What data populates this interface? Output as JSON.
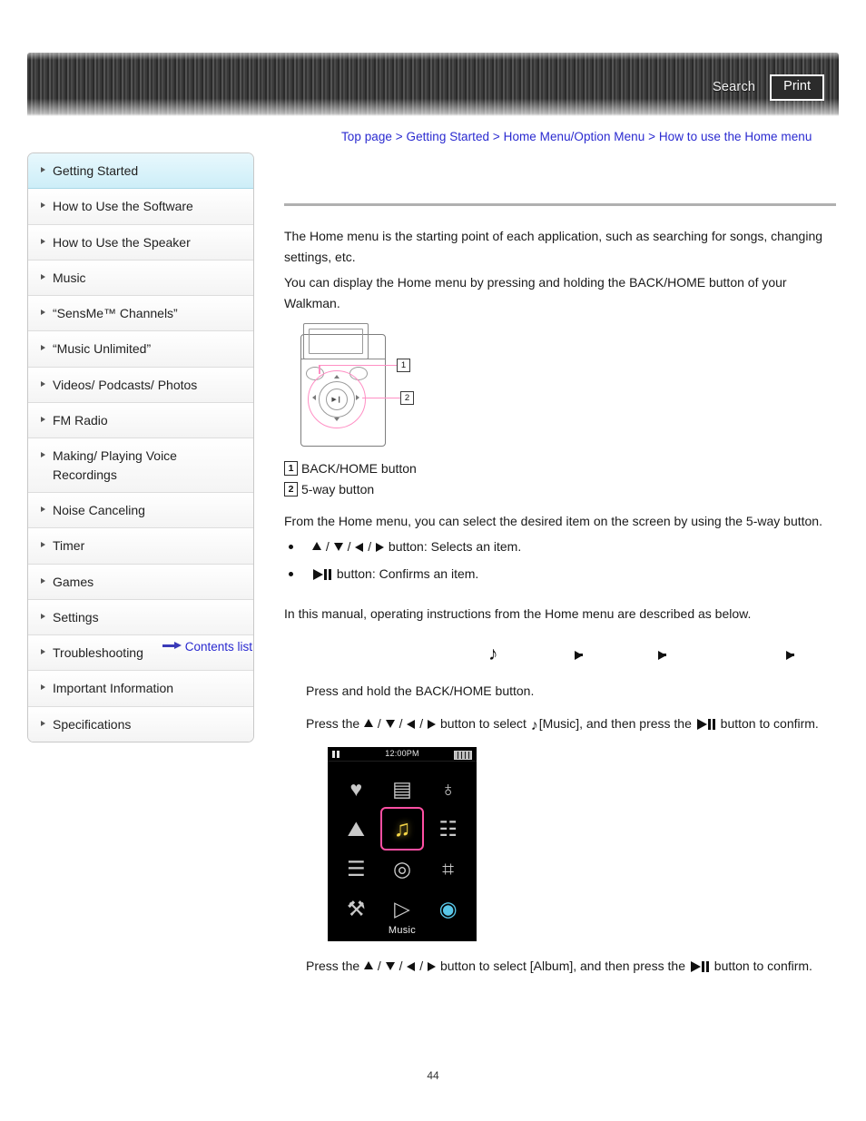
{
  "header": {
    "search_label": "Search",
    "print_label": "Print"
  },
  "breadcrumb": {
    "items": [
      {
        "label": "Top page"
      },
      {
        "label": "Getting Started"
      },
      {
        "label": "Home Menu/Option Menu"
      },
      {
        "label": "How to use the Home menu"
      }
    ],
    "separator": ">",
    "full_text": "Top page > Getting Started > Home Menu/Option Menu > How to use the Home menu"
  },
  "sidebar": {
    "items": [
      {
        "label": "Getting Started",
        "active": true
      },
      {
        "label": "How to Use the Software",
        "active": false
      },
      {
        "label": "How to Use the Speaker",
        "active": false
      },
      {
        "label": "Music",
        "active": false
      },
      {
        "label": "“SensMe™ Channels”",
        "active": false
      },
      {
        "label": "“Music Unlimited”",
        "active": false
      },
      {
        "label": "Videos/ Podcasts/ Photos",
        "active": false
      },
      {
        "label": "FM Radio",
        "active": false
      },
      {
        "label": "Making/ Playing Voice Recordings",
        "active": false
      },
      {
        "label": "Noise Canceling",
        "active": false
      },
      {
        "label": "Timer",
        "active": false
      },
      {
        "label": "Games",
        "active": false
      },
      {
        "label": "Settings",
        "active": false
      },
      {
        "label": "Troubleshooting",
        "active": false
      },
      {
        "label": "Important Information",
        "active": false
      },
      {
        "label": "Specifications",
        "active": false
      }
    ],
    "contents_link": "Contents list"
  },
  "main": {
    "intro_line1": "The Home menu is the starting point of each application, such as searching for songs, changing settings, etc.",
    "intro_line2": "You can display the Home menu by pressing and holding the BACK/HOME button of your Walkman.",
    "legend": [
      {
        "num": "1",
        "label": "BACK/HOME button"
      },
      {
        "num": "2",
        "label": "5-way button"
      }
    ],
    "fiveway_intro": "From the Home menu, you can select the desired item on the screen by using the 5-way button.",
    "bullet1_suffix": "button: Selects an item.",
    "bullet2_suffix": "button: Confirms an item.",
    "manual_note": "In this manual, operating instructions from the Home menu are described as below.",
    "step1": "Press and hold the BACK/HOME button.",
    "step2_a": "Press the",
    "step2_b": "button to select",
    "step2_c": "[Music], and then press the",
    "step2_d": "button to confirm.",
    "step3_a": "Press the",
    "step3_b": "button to select [Album], and then press the",
    "step3_c": "button to confirm.",
    "separator_slash": "/"
  },
  "home_screen": {
    "time": "12:00PM",
    "selected_label": "Music",
    "icons": [
      {
        "name": "sensme-heart-icon",
        "glyph": "♥",
        "selected": false
      },
      {
        "name": "fm-radio-icon",
        "glyph": "▤",
        "selected": false
      },
      {
        "name": "voice-recording-microphone-icon",
        "glyph": "♁",
        "selected": false
      },
      {
        "name": "photo-icon",
        "glyph": "⛰",
        "selected": false
      },
      {
        "name": "music-icon",
        "glyph": "♫",
        "selected": true
      },
      {
        "name": "video-icon",
        "glyph": "☷",
        "selected": false
      },
      {
        "name": "playlist-icon",
        "glyph": "☰",
        "selected": false
      },
      {
        "name": "noise-canceling-icon",
        "glyph": "◎",
        "selected": false
      },
      {
        "name": "games-icon",
        "glyph": "⌗",
        "selected": false
      },
      {
        "name": "settings-toolbox-icon",
        "glyph": "⚒",
        "selected": false
      },
      {
        "name": "music-video-icon",
        "glyph": "▷",
        "selected": false
      },
      {
        "name": "music-unlimited-globe-icon",
        "glyph": "◉",
        "selected": false
      }
    ]
  },
  "footer": {
    "page_number": "44"
  },
  "colors": {
    "link": "#2a2ad0",
    "accent_pink": "#ff4fa3",
    "sidebar_active": "#cdeef8",
    "selected_icon": "#f5d547"
  }
}
